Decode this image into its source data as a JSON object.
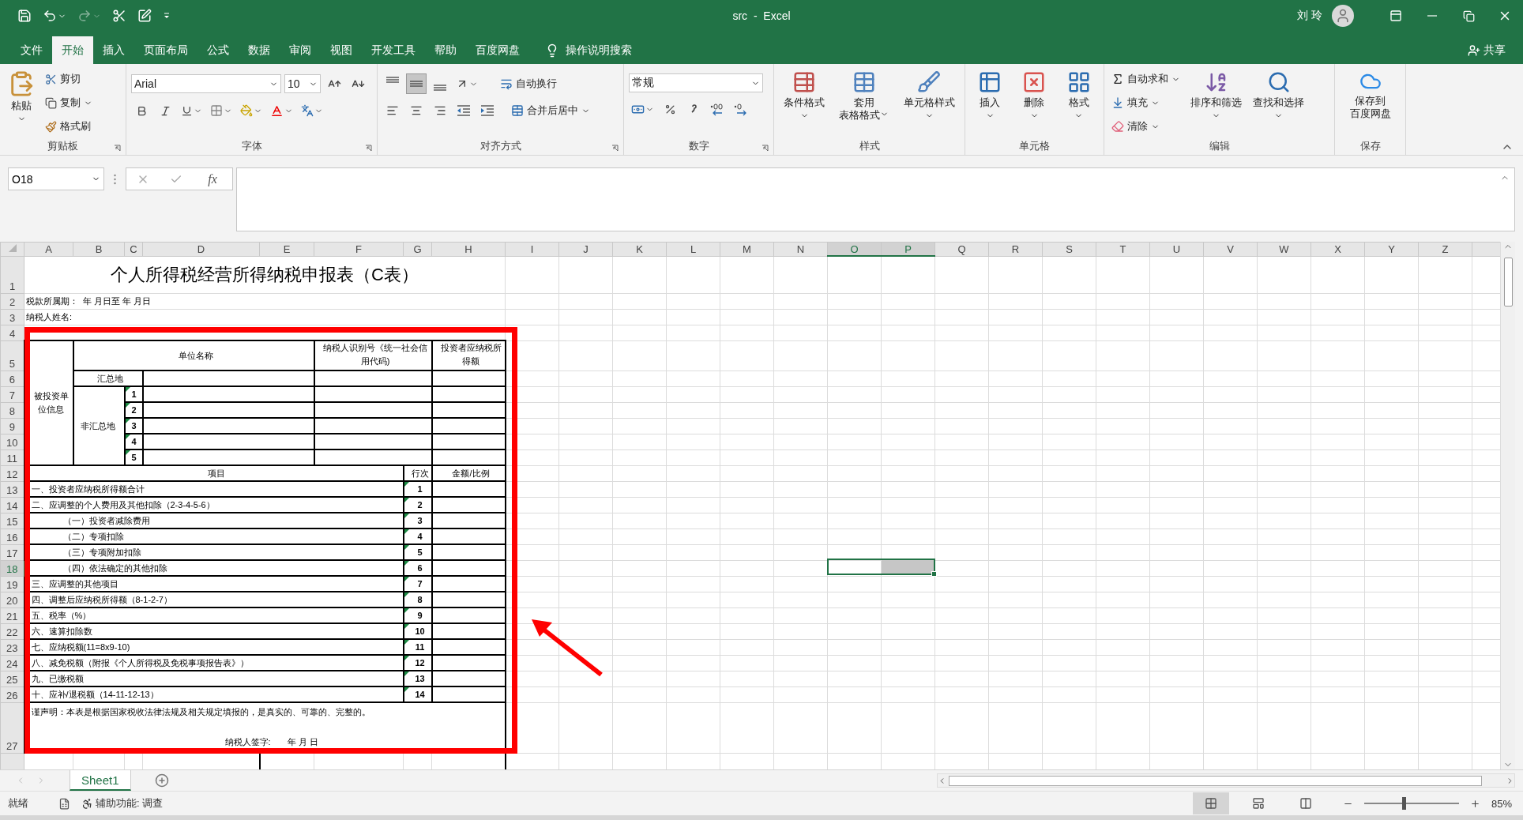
{
  "window": {
    "title": "src  -  Excel",
    "user": "刘 玲"
  },
  "quick_access": [
    {
      "kind": "save",
      "disabled": false
    },
    {
      "kind": "undo",
      "disabled": false
    },
    {
      "kind": "redo",
      "disabled": true
    },
    {
      "kind": "cut",
      "disabled": false
    },
    {
      "kind": "preview",
      "disabled": false
    },
    {
      "kind": "customize",
      "disabled": false
    }
  ],
  "ribbon_tabs": [
    {
      "label": "文件",
      "selected": false
    },
    {
      "label": "开始",
      "selected": true
    },
    {
      "label": "插入",
      "selected": false
    },
    {
      "label": "页面布局",
      "selected": false
    },
    {
      "label": "公式",
      "selected": false
    },
    {
      "label": "数据",
      "selected": false
    },
    {
      "label": "审阅",
      "selected": false
    },
    {
      "label": "视图",
      "selected": false
    },
    {
      "label": "开发工具",
      "selected": false
    },
    {
      "label": "帮助",
      "selected": false
    },
    {
      "label": "百度网盘",
      "selected": false
    }
  ],
  "tell_me": "操作说明搜索",
  "share": "共享",
  "ribbon": {
    "clipboard": {
      "label": "剪贴板",
      "paste": "粘贴",
      "cut": "剪切",
      "copy": "复制",
      "format_painter": "格式刷"
    },
    "font": {
      "label": "字体",
      "font_name": "Arial",
      "font_size": "10"
    },
    "alignment": {
      "label": "对齐方式",
      "wrap_text": "自动换行",
      "merge_center": "合并后居中",
      "vertical_align": [
        {
          "kind": "top",
          "selected": false
        },
        {
          "kind": "middle",
          "selected": true
        },
        {
          "kind": "bottom",
          "selected": false
        }
      ]
    },
    "number": {
      "label": "数字",
      "format": "常规"
    },
    "styles": {
      "label": "样式",
      "conditional": "条件格式",
      "table_format": [
        "套用",
        "表格格式"
      ],
      "cell_styles": "单元格样式"
    },
    "cells": {
      "label": "单元格",
      "insert": "插入",
      "delete": "删除",
      "format": "格式"
    },
    "editing": {
      "label": "编辑",
      "autosum": "自动求和",
      "fill": "填充",
      "clear": "清除",
      "sort_filter": "排序和筛选",
      "find_select": "查找和选择"
    },
    "save": {
      "label": "保存",
      "save_to_cloud": [
        "保存到",
        "百度网盘"
      ]
    }
  },
  "formula_bar": {
    "name_box": "O18",
    "function_label": "fx"
  },
  "sheet": {
    "columns": [
      {
        "label": "A",
        "selected": false
      },
      {
        "label": "B",
        "selected": false
      },
      {
        "label": "C",
        "selected": false
      },
      {
        "label": "D",
        "selected": false
      },
      {
        "label": "E",
        "selected": false
      },
      {
        "label": "F",
        "selected": false
      },
      {
        "label": "G",
        "selected": false
      },
      {
        "label": "H",
        "selected": false
      },
      {
        "label": "I",
        "selected": false
      },
      {
        "label": "J",
        "selected": false
      },
      {
        "label": "K",
        "selected": false
      },
      {
        "label": "L",
        "selected": false
      },
      {
        "label": "M",
        "selected": false
      },
      {
        "label": "N",
        "selected": false
      },
      {
        "label": "O",
        "selected": true
      },
      {
        "label": "P",
        "selected": true
      },
      {
        "label": "Q",
        "selected": false
      },
      {
        "label": "R",
        "selected": false
      },
      {
        "label": "S",
        "selected": false
      },
      {
        "label": "T",
        "selected": false
      },
      {
        "label": "U",
        "selected": false
      },
      {
        "label": "V",
        "selected": false
      },
      {
        "label": "W",
        "selected": false
      },
      {
        "label": "X",
        "selected": false
      },
      {
        "label": "Y",
        "selected": false
      },
      {
        "label": "Z",
        "selected": false
      }
    ],
    "rows": [
      {
        "label": "1",
        "selected": false
      },
      {
        "label": "2",
        "selected": false
      },
      {
        "label": "3",
        "selected": false
      },
      {
        "label": "4",
        "selected": false
      },
      {
        "label": "5",
        "selected": false
      },
      {
        "label": "6",
        "selected": false
      },
      {
        "label": "7",
        "selected": false
      },
      {
        "label": "8",
        "selected": false
      },
      {
        "label": "9",
        "selected": false
      },
      {
        "label": "10",
        "selected": false
      },
      {
        "label": "11",
        "selected": false
      },
      {
        "label": "12",
        "selected": false
      },
      {
        "label": "13",
        "selected": false
      },
      {
        "label": "14",
        "selected": false
      },
      {
        "label": "15",
        "selected": false
      },
      {
        "label": "16",
        "selected": false
      },
      {
        "label": "17",
        "selected": false
      },
      {
        "label": "18",
        "selected": true
      },
      {
        "label": "19",
        "selected": false
      },
      {
        "label": "20",
        "selected": false
      },
      {
        "label": "21",
        "selected": false
      },
      {
        "label": "22",
        "selected": false
      },
      {
        "label": "23",
        "selected": false
      },
      {
        "label": "24",
        "selected": false
      },
      {
        "label": "25",
        "selected": false
      },
      {
        "label": "26",
        "selected": false
      },
      {
        "label": "27",
        "selected": false
      }
    ],
    "form": {
      "title": "个人所得税经营所得纳税申报表（C表）",
      "period": "税款所属期：  年 月日至 年 月日",
      "taxpayer_name": "纳税人姓名:",
      "investee": {
        "section_label": "被投资单位信息",
        "unit_name_header": "单位名称",
        "tax_id_header": "纳税人识别号《统一社会信用代码)",
        "income_header": "投资者应纳税所得额",
        "head_office": "汇总地",
        "branch_label": "非汇总地",
        "branches": [
          {
            "label": "1",
            "flagged": true
          },
          {
            "label": "2",
            "flagged": true
          },
          {
            "label": "3",
            "flagged": true
          },
          {
            "label": "4",
            "flagged": true
          },
          {
            "label": "5",
            "flagged": true
          }
        ]
      },
      "item_header": "项目",
      "line_header": "行次",
      "amount_header": "金额/比例",
      "items": [
        {
          "text": "一、投资者应纳税所得额合计",
          "line": "1",
          "flagged": true
        },
        {
          "text": "二、应调整的个人费用及其他扣除（2-3-4-5-6）",
          "line": "2",
          "flagged": true,
          "children": [
            {
              "text": "（一）投资者减除费用",
              "line": "3",
              "flagged": true
            },
            {
              "text": "（二）专项扣除",
              "line": "4",
              "flagged": true
            },
            {
              "text": "（三）专项附加扣除",
              "line": "5",
              "flagged": true
            },
            {
              "text": "（四）依法确定的其他扣除",
              "line": "6",
              "flagged": true
            }
          ]
        },
        {
          "text": "三、应调整的其他项目",
          "line": "7",
          "flagged": true
        },
        {
          "text": "四、调整后应纳税所得额（8-1-2-7）",
          "line": "8",
          "flagged": true
        },
        {
          "text": "五、税率（%）",
          "line": "9",
          "flagged": true
        },
        {
          "text": "六、速算扣除数",
          "line": "10",
          "flagged": true
        },
        {
          "text": "七、应纳税额(11=8x9-10)",
          "line": "11",
          "flagged": true
        },
        {
          "text": "八、减免税额（附报《个人所得税及免税事项报告表》）",
          "line": "12",
          "flagged": true
        },
        {
          "text": "九、已缴税额",
          "line": "13",
          "flagged": true
        },
        {
          "text": "十、应补/退税额（14-11-12-13）",
          "line": "14",
          "flagged": true
        }
      ],
      "declaration": "谨声明：本表是根据国家税收法律法规及相关规定填报的，是真实的、可靠的、完整的。",
      "signature": "纳税人签字:       年 月 日"
    }
  },
  "sheet_tabs": [
    {
      "label": "Sheet1",
      "selected": true
    }
  ],
  "status_bar": {
    "ready": "就绪",
    "accessibility": "辅助功能: 调查",
    "views": [
      {
        "kind": "normal",
        "selected": true
      },
      {
        "kind": "page_layout",
        "selected": false
      },
      {
        "kind": "page_break",
        "selected": false
      }
    ],
    "zoom": {
      "level": 0.42,
      "reading": "85%"
    }
  }
}
